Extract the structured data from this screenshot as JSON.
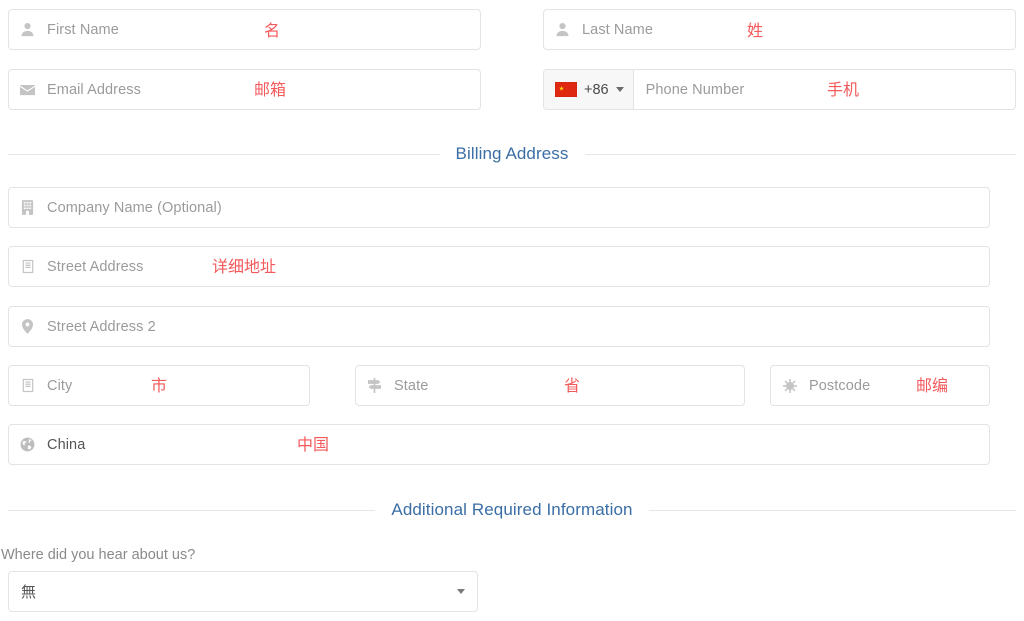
{
  "form": {
    "name_row": {
      "first_name": {
        "placeholder": "First Name",
        "icon": "user-icon",
        "annotation": "名"
      },
      "last_name": {
        "placeholder": "Last Name",
        "icon": "user-icon",
        "annotation": "姓"
      }
    },
    "contact_row": {
      "email": {
        "placeholder": "Email Address",
        "icon": "envelope-icon",
        "annotation": "邮箱"
      },
      "phone": {
        "placeholder": "Phone Number",
        "dial_code": "+86",
        "flag": "china-flag-icon",
        "annotation": "手机"
      }
    },
    "billing_section": {
      "title": "Billing Address",
      "company": {
        "placeholder": "Company Name (Optional)",
        "icon": "building-icon",
        "annotation": ""
      },
      "street1": {
        "placeholder": "Street Address",
        "icon": "building-icon",
        "annotation": "详细地址"
      },
      "street2": {
        "placeholder": "Street Address 2",
        "icon": "map-marker-icon",
        "annotation": ""
      },
      "city": {
        "placeholder": "City",
        "icon": "building-icon",
        "annotation": "市"
      },
      "state": {
        "placeholder": "State",
        "icon": "map-signs-icon",
        "annotation": "省"
      },
      "postcode": {
        "placeholder": "Postcode",
        "icon": "sun-icon",
        "annotation": "邮编"
      },
      "country": {
        "value": "China",
        "icon": "globe-icon",
        "annotation": "中国"
      }
    },
    "additional_section": {
      "title": "Additional Required Information",
      "question_label": "Where did you hear about us?",
      "select": {
        "value": "無",
        "options": [
          "無"
        ]
      }
    }
  },
  "colors": {
    "annotation_red": "#f4595b",
    "section_title_blue": "#3a6ea5",
    "border_gray": "#e3e3e3",
    "placeholder_gray": "#9b9b9b",
    "flag_red": "#de2910",
    "flag_star_yellow": "#ffde00"
  }
}
